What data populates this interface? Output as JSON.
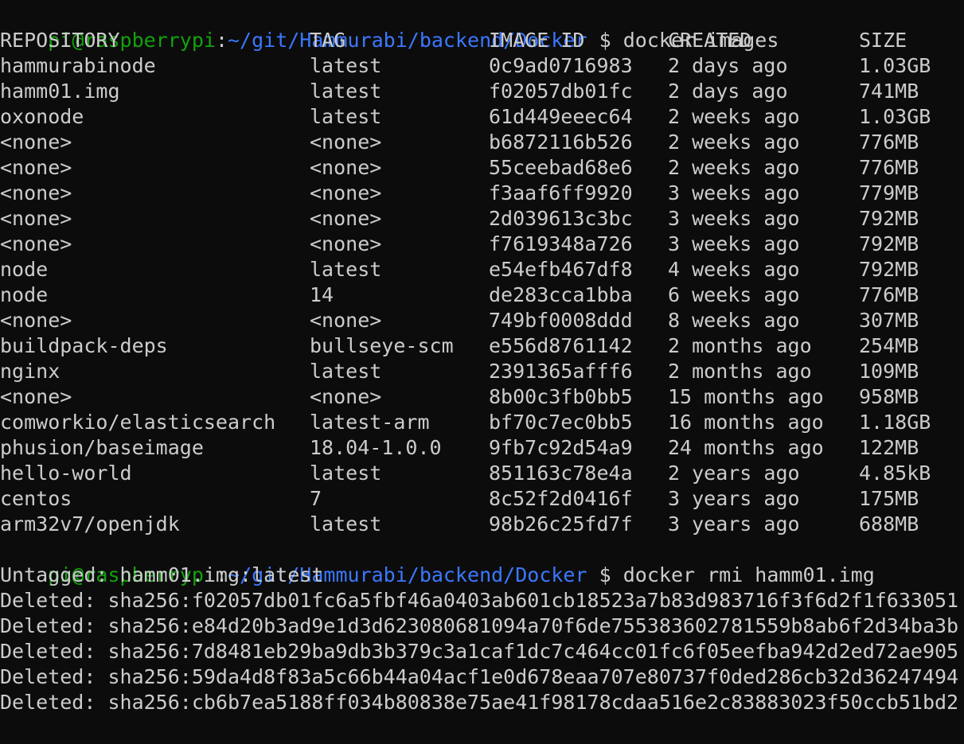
{
  "colors": {
    "background": "#0c0c0c",
    "text": "#cccccc",
    "prompt_user": "#13a10e",
    "prompt_path": "#3b78ff"
  },
  "prompt": {
    "user_host": "pi@raspberrypi",
    "separator": ":",
    "path": "~/git/Hammurabi/backend/Docker",
    "symbol": "$"
  },
  "commands": {
    "first": "docker images",
    "second": "docker rmi hamm01.img"
  },
  "images_table": {
    "headers": [
      "REPOSITORY",
      "TAG",
      "IMAGE ID",
      "CREATED",
      "SIZE"
    ],
    "rows": [
      [
        "hammurabinode",
        "latest",
        "0c9ad0716983",
        "2 days ago",
        "1.03GB"
      ],
      [
        "hamm01.img",
        "latest",
        "f02057db01fc",
        "2 days ago",
        "741MB"
      ],
      [
        "oxonode",
        "latest",
        "61d449eeec64",
        "2 weeks ago",
        "1.03GB"
      ],
      [
        "<none>",
        "<none>",
        "b6872116b526",
        "2 weeks ago",
        "776MB"
      ],
      [
        "<none>",
        "<none>",
        "55ceebad68e6",
        "2 weeks ago",
        "776MB"
      ],
      [
        "<none>",
        "<none>",
        "f3aaf6ff9920",
        "3 weeks ago",
        "779MB"
      ],
      [
        "<none>",
        "<none>",
        "2d039613c3bc",
        "3 weeks ago",
        "792MB"
      ],
      [
        "<none>",
        "<none>",
        "f7619348a726",
        "3 weeks ago",
        "792MB"
      ],
      [
        "node",
        "latest",
        "e54efb467df8",
        "4 weeks ago",
        "792MB"
      ],
      [
        "node",
        "14",
        "de283cca1bba",
        "6 weeks ago",
        "776MB"
      ],
      [
        "<none>",
        "<none>",
        "749bf0008ddd",
        "8 weeks ago",
        "307MB"
      ],
      [
        "buildpack-deps",
        "bullseye-scm",
        "e556d8761142",
        "2 months ago",
        "254MB"
      ],
      [
        "nginx",
        "latest",
        "2391365afff6",
        "2 months ago",
        "109MB"
      ],
      [
        "<none>",
        "<none>",
        "8b00c3fb0bb5",
        "15 months ago",
        "958MB"
      ],
      [
        "comworkio/elasticsearch",
        "latest-arm",
        "bf70c7ec0bb5",
        "16 months ago",
        "1.18GB"
      ],
      [
        "phusion/baseimage",
        "18.04-1.0.0",
        "9fb7c92d54a9",
        "24 months ago",
        "122MB"
      ],
      [
        "hello-world",
        "latest",
        "851163c78e4a",
        "2 years ago",
        "4.85kB"
      ],
      [
        "centos",
        "7",
        "8c52f2d0416f",
        "3 years ago",
        "175MB"
      ],
      [
        "arm32v7/openjdk",
        "latest",
        "98b26c25fd7f",
        "3 years ago",
        "688MB"
      ]
    ]
  },
  "rmi_output": [
    "Untagged: hamm01.img:latest",
    "Deleted: sha256:f02057db01fc6a5fbf46a0403ab601cb18523a7b83d983716f3f6d2f1f633051",
    "Deleted: sha256:e84d20b3ad9e1d3d623080681094a70f6de755383602781559b8ab6f2d34ba3b",
    "Deleted: sha256:7d8481eb29ba9db3b379c3a1caf1dc7c464cc01fc6f05eefba942d2ed72ae905",
    "Deleted: sha256:59da4d8f83a5c66b44a04acf1e0d678eaa707e80737f0ded286cb32d36247494",
    "Deleted: sha256:cb6b7ea5188ff034b80838e75ae41f98178cdaa516e2c83883023f50ccb51bd2"
  ]
}
